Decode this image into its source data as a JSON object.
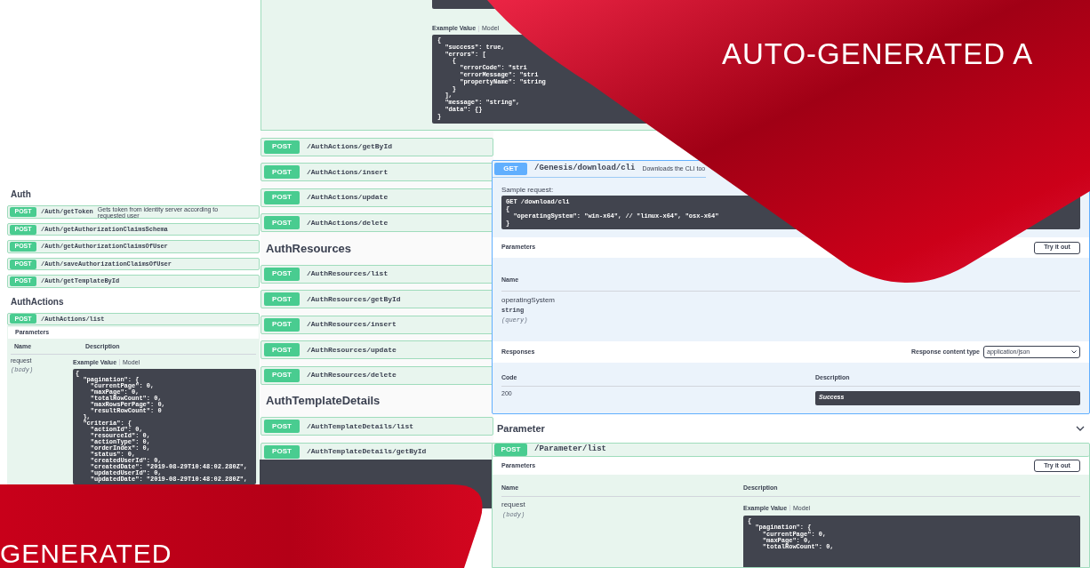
{
  "banner": {
    "headline": "AUTO-GENERATED A",
    "footer_text": "GENERATED"
  },
  "left_panel": {
    "sections": [
      {
        "title": "Auth",
        "operations": [
          {
            "method": "POST",
            "path": "/Auth/getToken",
            "summary": "Gets token from identity server according to requested user"
          },
          {
            "method": "POST",
            "path": "/Auth/getAuthorizationClaimsSchema"
          },
          {
            "method": "POST",
            "path": "/Auth/getAuthorizationClaimsOfUser"
          },
          {
            "method": "POST",
            "path": "/Auth/saveAuthorizationClaimsOfUser"
          },
          {
            "method": "POST",
            "path": "/Auth/getTemplateById"
          }
        ]
      },
      {
        "title": "AuthActions",
        "operations": [
          {
            "method": "POST",
            "path": "/AuthActions/list"
          }
        ]
      }
    ],
    "details": {
      "parameters_label": "Parameters",
      "name_header": "Name",
      "description_header": "Description",
      "param_name": "request",
      "param_in": "(body)",
      "example_tab": "Example Value",
      "model_tab": "Model",
      "code": [
        "{",
        "  \"pagination\": {",
        "    \"currentPage\": 0,",
        "    \"maxPage\": 0,",
        "    \"totalRowCount\": 0,",
        "    \"maxRowsPerPage\": 0,",
        "    \"resultRowCount\": 0",
        "  },",
        "  \"criteria\": {",
        "    \"actionId\": 0,",
        "    \"resourceId\": 0,",
        "    \"actionType\": 0,",
        "    \"orderIndex\": 0,",
        "    \"status\": 0,",
        "    \"createdUserId\": 0,",
        "    \"createdDate\": \"2019-08-29T10:48:02.280Z\",",
        "    \"updatedUserId\": 0,",
        "    \"updatedDate\": \"2019-08-29T10:48:02.280Z\","
      ]
    }
  },
  "middle_panel": {
    "example_tab": "Example Value",
    "model_tab": "Model",
    "code": [
      "{",
      "  \"success\": true,",
      "  \"errors\": [",
      "    {",
      "      \"errorCode\": \"stri",
      "      \"errorMessage\": \"stri",
      "      \"propertyName\": \"string",
      "    }",
      "  ],",
      "  \"message\": \"string\",",
      "  \"data\": {}",
      "}"
    ],
    "items": [
      {
        "kind": "operation",
        "method": "POST",
        "path": "/AuthActions/getById"
      },
      {
        "kind": "operation",
        "method": "POST",
        "path": "/AuthActions/insert"
      },
      {
        "kind": "operation",
        "method": "POST",
        "path": "/AuthActions/update"
      },
      {
        "kind": "operation",
        "method": "POST",
        "path": "/AuthActions/delete"
      },
      {
        "kind": "heading",
        "title": "AuthResources"
      },
      {
        "kind": "operation",
        "method": "POST",
        "path": "/AuthResources/list"
      },
      {
        "kind": "operation",
        "method": "POST",
        "path": "/AuthResources/getById"
      },
      {
        "kind": "operation",
        "method": "POST",
        "path": "/AuthResources/insert"
      },
      {
        "kind": "operation",
        "method": "POST",
        "path": "/AuthResources/update"
      },
      {
        "kind": "operation",
        "method": "POST",
        "path": "/AuthResources/delete"
      },
      {
        "kind": "heading",
        "title": "AuthTemplateDetails"
      },
      {
        "kind": "operation",
        "method": "POST",
        "path": "/AuthTemplateDetails/list"
      },
      {
        "kind": "operation",
        "method": "POST",
        "path": "/AuthTemplateDetails/getById"
      }
    ]
  },
  "right_panel": {
    "operation": {
      "method": "GET",
      "path": "/Genesis/download/cli",
      "summary": "Downloads the CLI too"
    },
    "sample_label": "Sample request:",
    "sample_code": [
      "GET /download/cli",
      "{",
      "  \"operatingSystem\": \"win-x64\", // \"linux-x64\", \"osx-x64\"",
      "}"
    ],
    "parameters_label": "Parameters",
    "try_button": "Try it out",
    "name_header": "Name",
    "param_name": "operatingSystem",
    "param_type": "string",
    "param_in": "(query)",
    "responses_label": "Responses",
    "content_type_label": "Response content type",
    "content_type": "application/json",
    "code_header": "Code",
    "description_header": "Description",
    "response_code": "200",
    "response_description": "Success",
    "section": {
      "title": "Parameter",
      "expanded": true,
      "operation": {
        "method": "POST",
        "path": "/Parameter/list"
      },
      "parameters_label": "Parameters",
      "try_button": "Try it out",
      "name_header": "Name",
      "description_header": "Description",
      "param_name": "request",
      "param_in": "(body)",
      "example_tab": "Example Value",
      "model_tab": "Model",
      "code": [
        "{",
        "  \"pagination\": {",
        "    \"currentPage\": 0,",
        "    \"maxPage\": 0,",
        "    \"totalRowCount\": 0,"
      ]
    }
  }
}
